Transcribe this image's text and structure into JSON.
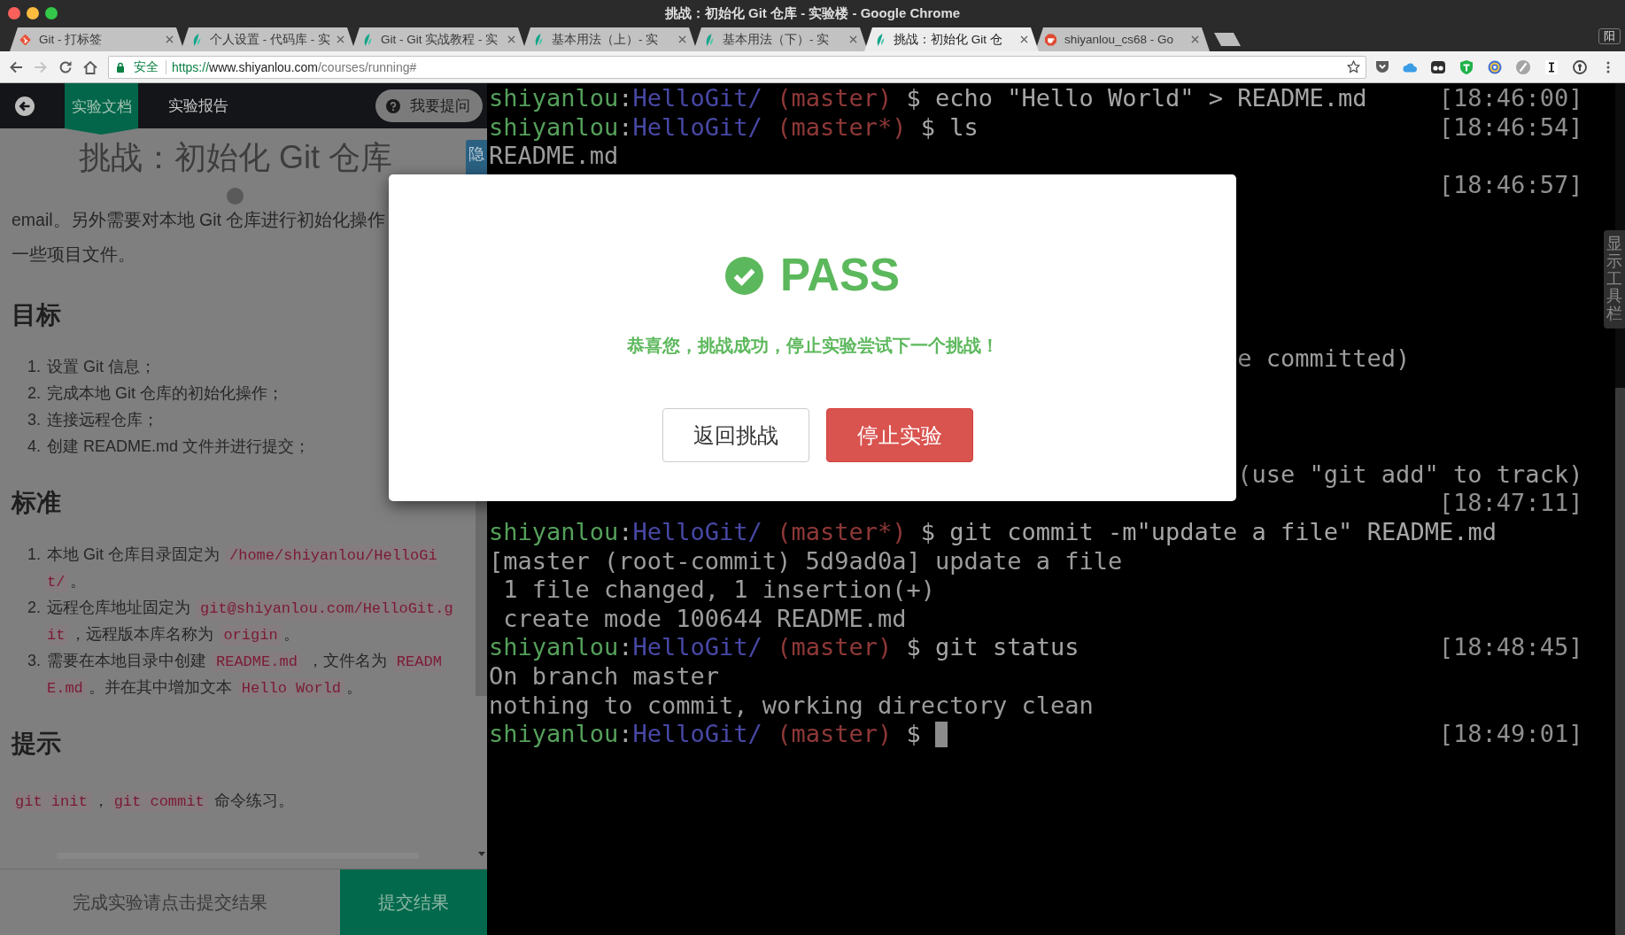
{
  "window": {
    "title": "挑战：初始化 Git 仓库 - 实验楼 - Google Chrome",
    "profile_badge": "阳"
  },
  "tabs": [
    {
      "kind": "diamond",
      "title": "Git - 打标签",
      "selected": false
    },
    {
      "kind": "leaf",
      "title": "个人设置 - 代码库 - 实",
      "selected": false
    },
    {
      "kind": "leaf",
      "title": "Git - Git 实战教程 - 实",
      "selected": false
    },
    {
      "kind": "leaf",
      "title": "基本用法（上）- 实",
      "selected": false
    },
    {
      "kind": "leaf",
      "title": "基本用法（下）- 实",
      "selected": false
    },
    {
      "kind": "leaf",
      "title": "挑战：初始化 Git 仓",
      "selected": true
    },
    {
      "kind": "octagon",
      "title": "shiyanlou_cs68 - Go",
      "selected": false
    }
  ],
  "toolbar": {
    "back": {
      "disabled": false
    },
    "forward": {
      "disabled": true
    },
    "security_label": "安全",
    "url_parts": [
      {
        "kind": "scheme",
        "text": "https://"
      },
      {
        "kind": "host",
        "text": "www.shiyanlou.com"
      },
      {
        "kind": "path",
        "text": "/courses/running#"
      }
    ]
  },
  "lab_panel": {
    "nav_tabs": [
      {
        "label": "实验文档",
        "selected": true
      },
      {
        "label": "实验报告",
        "selected": false
      }
    ],
    "ask_button": "我要提问",
    "hide_tab": "隐",
    "doc": {
      "title": "挑战：初始化 Git 仓库",
      "intro_lines": [
        "email。另外需要对本地 Git 仓库进行初始化操作",
        "一些项目文件。"
      ],
      "sections": [
        {
          "heading": "目标",
          "kind": "list",
          "items": [
            {
              "number": "1.",
              "lines": [
                [
                  {
                    "kind": "text",
                    "text": "设置 Git 信息；"
                  }
                ]
              ]
            },
            {
              "number": "2.",
              "lines": [
                [
                  {
                    "kind": "text",
                    "text": "完成本地 Git 仓库的初始化操作；"
                  }
                ]
              ]
            },
            {
              "number": "3.",
              "lines": [
                [
                  {
                    "kind": "text",
                    "text": "连接远程仓库；"
                  }
                ]
              ]
            },
            {
              "number": "4.",
              "lines": [
                [
                  {
                    "kind": "text",
                    "text": "创建 README.md 文件并进行提交；"
                  }
                ]
              ]
            }
          ]
        },
        {
          "heading": "标准",
          "kind": "list",
          "items": [
            {
              "number": "1.",
              "lines": [
                [
                  {
                    "kind": "text",
                    "text": "本地 Git 仓库目录固定为 "
                  },
                  {
                    "kind": "code",
                    "text": "/home/shiyanlou/HelloGi"
                  }
                ],
                [
                  {
                    "kind": "code",
                    "text": "t/"
                  },
                  {
                    "kind": "text",
                    "text": "。"
                  }
                ]
              ]
            },
            {
              "number": "2.",
              "lines": [
                [
                  {
                    "kind": "text",
                    "text": "远程仓库地址固定为 "
                  },
                  {
                    "kind": "code",
                    "text": "git@shiyanlou.com/HelloGit.g"
                  }
                ],
                [
                  {
                    "kind": "code",
                    "text": "it"
                  },
                  {
                    "kind": "text",
                    "text": "，远程版本库名称为 "
                  },
                  {
                    "kind": "code",
                    "text": "origin"
                  },
                  {
                    "kind": "text",
                    "text": "。"
                  }
                ]
              ]
            },
            {
              "number": "3.",
              "lines": [
                [
                  {
                    "kind": "text",
                    "text": "需要在本地目录中创建 "
                  },
                  {
                    "kind": "code",
                    "text": "README.md"
                  },
                  {
                    "kind": "text",
                    "text": " ，文件名为 "
                  },
                  {
                    "kind": "code",
                    "text": "READM"
                  }
                ],
                [
                  {
                    "kind": "code",
                    "text": "E.md"
                  },
                  {
                    "kind": "text",
                    "text": "。并在其中增加文本 "
                  },
                  {
                    "kind": "code",
                    "text": "Hello World"
                  },
                  {
                    "kind": "text",
                    "text": "。"
                  }
                ]
              ]
            }
          ]
        },
        {
          "heading": "提示",
          "kind": "paragraph",
          "lines": [
            [
              {
                "kind": "code",
                "text": "git init"
              },
              {
                "kind": "text",
                "text": "，"
              },
              {
                "kind": "code",
                "text": "git commit"
              },
              {
                "kind": "text",
                "text": " 命令练习。"
              }
            ]
          ]
        }
      ]
    },
    "footer": {
      "hint": "完成实验请点击提交结果",
      "submit_button": "提交结果"
    }
  },
  "terminal": {
    "lines": [
      {
        "kind": "prompt",
        "segments": [
          {
            "kind": "user",
            "text": "shiyanlou"
          },
          {
            "kind": "sep",
            "text": ":"
          },
          {
            "kind": "path",
            "text": "HelloGit/ "
          },
          {
            "kind": "branch",
            "text": "(master)"
          },
          {
            "kind": "command",
            "text": " $ echo \"Hello World\" > README.md"
          }
        ],
        "time": "[18:46:00]"
      },
      {
        "kind": "prompt",
        "segments": [
          {
            "kind": "user",
            "text": "shiyanlou"
          },
          {
            "kind": "sep",
            "text": ":"
          },
          {
            "kind": "path",
            "text": "HelloGit/ "
          },
          {
            "kind": "branch",
            "text": "(master*)"
          },
          {
            "kind": "command",
            "text": " $ ls"
          }
        ],
        "time": "[18:46:54]"
      },
      {
        "kind": "output",
        "text": "README.md"
      },
      {
        "kind": "covered",
        "time": "[18:46:57]"
      },
      {
        "kind": "covered"
      },
      {
        "kind": "covered"
      },
      {
        "kind": "covered"
      },
      {
        "kind": "covered"
      },
      {
        "kind": "covered"
      },
      {
        "kind": "covered",
        "text": "e committed)"
      },
      {
        "kind": "covered"
      },
      {
        "kind": "covered"
      },
      {
        "kind": "covered"
      },
      {
        "kind": "covered",
        "text": "(use \"git add\" to track)"
      },
      {
        "kind": "covered",
        "time": "[18:47:11]"
      },
      {
        "kind": "prompt",
        "segments": [
          {
            "kind": "user",
            "text": "shiyanlou"
          },
          {
            "kind": "sep",
            "text": ":"
          },
          {
            "kind": "path",
            "text": "HelloGit/ "
          },
          {
            "kind": "branch",
            "text": "(master*)"
          },
          {
            "kind": "command",
            "text": " $ git commit -m\"update a file\" README.md"
          }
        ]
      },
      {
        "kind": "output",
        "text": "[master (root-commit) 5d9ad0a] update a file"
      },
      {
        "kind": "output",
        "text": " 1 file changed, 1 insertion(+)"
      },
      {
        "kind": "output",
        "text": " create mode 100644 README.md"
      },
      {
        "kind": "prompt",
        "segments": [
          {
            "kind": "user",
            "text": "shiyanlou"
          },
          {
            "kind": "sep",
            "text": ":"
          },
          {
            "kind": "path",
            "text": "HelloGit/ "
          },
          {
            "kind": "branch",
            "text": "(master)"
          },
          {
            "kind": "command",
            "text": " $ git status"
          }
        ],
        "time": "[18:48:45]"
      },
      {
        "kind": "output",
        "text": "On branch master"
      },
      {
        "kind": "output",
        "text": "nothing to commit, working directory clean"
      },
      {
        "kind": "prompt",
        "segments": [
          {
            "kind": "user",
            "text": "shiyanlou"
          },
          {
            "kind": "sep",
            "text": ":"
          },
          {
            "kind": "path",
            "text": "HelloGit/ "
          },
          {
            "kind": "branch",
            "text": "(master)"
          },
          {
            "kind": "command",
            "text": " $ "
          }
        ],
        "cursor": true,
        "time": "[18:49:01]"
      }
    ]
  },
  "toolbar_toggle": "显示工具栏",
  "dialog": {
    "status": "PASS",
    "message": "恭喜您，挑战成功，停止实验尝试下一个挑战！",
    "buttons": [
      {
        "label": "返回挑战",
        "kind": "default"
      },
      {
        "label": "停止实验",
        "kind": "danger"
      }
    ]
  }
}
